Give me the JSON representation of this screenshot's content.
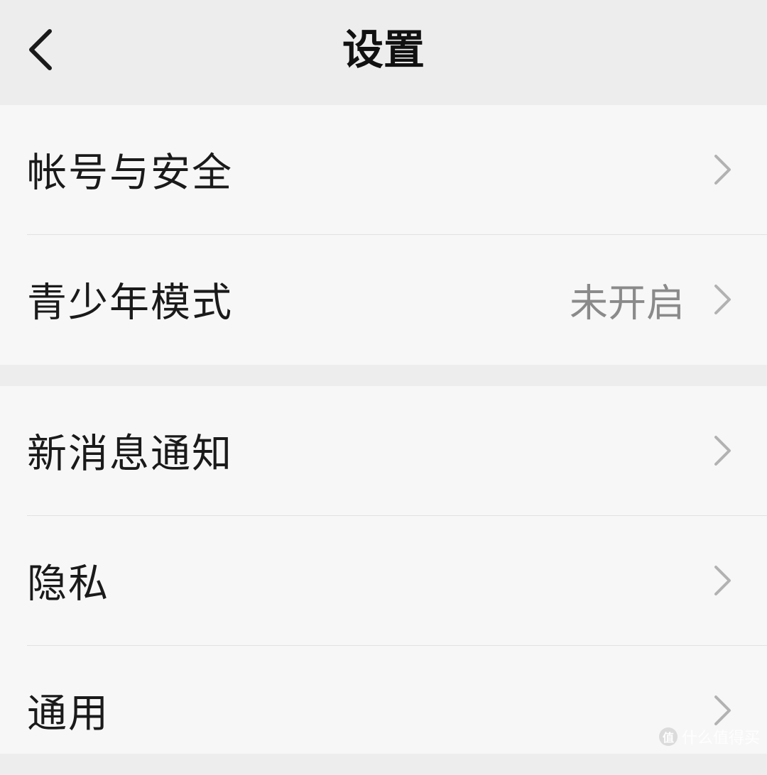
{
  "header": {
    "title": "设置",
    "back_icon": "chevron-left-icon"
  },
  "groups": [
    {
      "items": [
        {
          "label": "帐号与安全",
          "value": "",
          "icon": "chevron-right-icon"
        },
        {
          "label": "青少年模式",
          "value": "未开启",
          "icon": "chevron-right-icon"
        }
      ]
    },
    {
      "items": [
        {
          "label": "新消息通知",
          "value": "",
          "icon": "chevron-right-icon"
        },
        {
          "label": "隐私",
          "value": "",
          "icon": "chevron-right-icon"
        },
        {
          "label": "通用",
          "value": "",
          "icon": "chevron-right-icon"
        }
      ]
    }
  ],
  "watermark": {
    "logo": "值",
    "text": "什么值得买"
  },
  "colors": {
    "nav_background": "#ededed",
    "cell_background": "#f7f7f7",
    "divider": "#e2e2e2",
    "secondary_text": "#8a8a8a",
    "chevron": "#b2b2b2"
  }
}
